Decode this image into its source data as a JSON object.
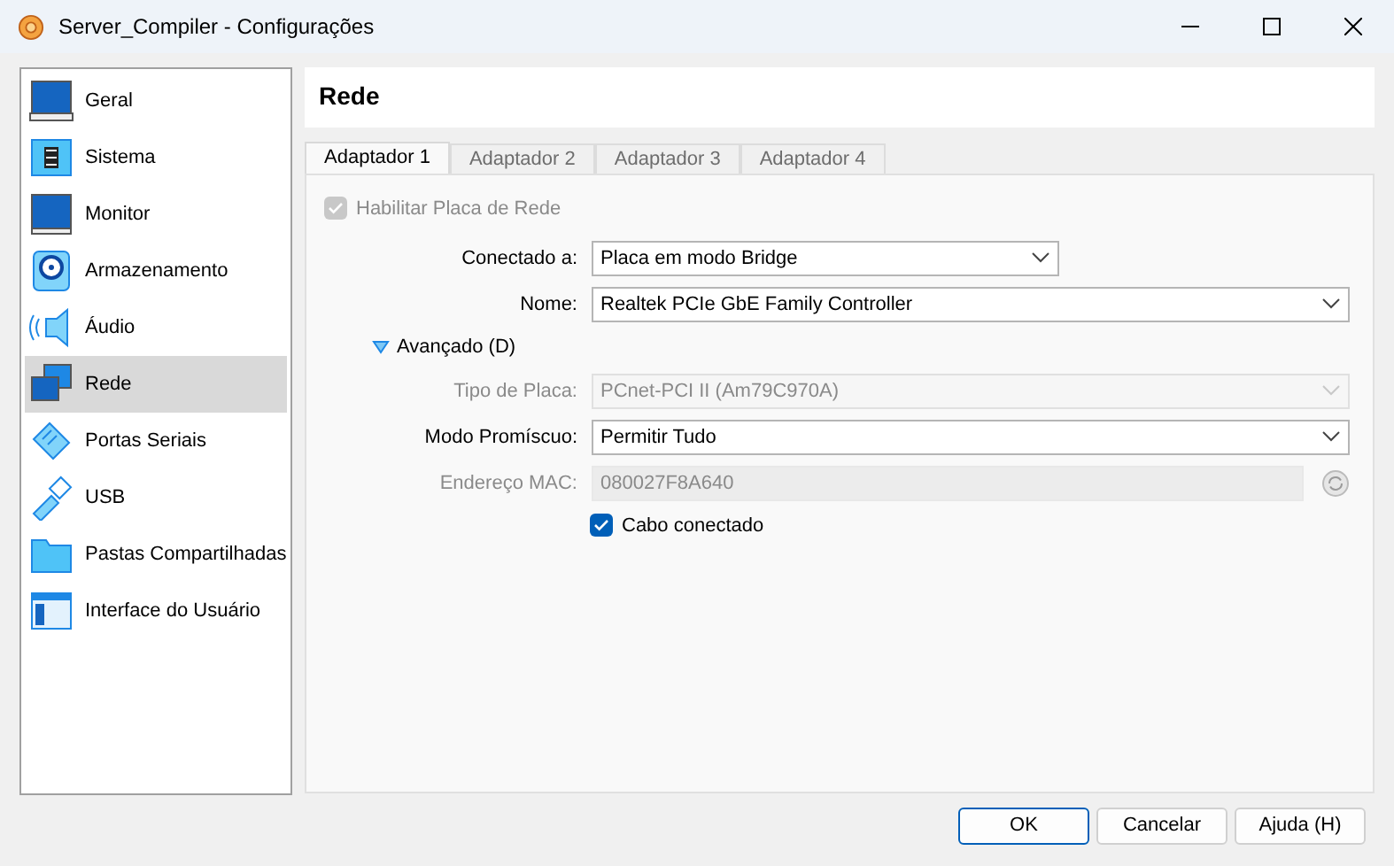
{
  "window": {
    "title": "Server_Compiler - Configurações"
  },
  "sidebar": {
    "items": [
      {
        "label": "Geral",
        "selected": false
      },
      {
        "label": "Sistema",
        "selected": false
      },
      {
        "label": "Monitor",
        "selected": false
      },
      {
        "label": "Armazenamento",
        "selected": false
      },
      {
        "label": "Áudio",
        "selected": false
      },
      {
        "label": "Rede",
        "selected": true
      },
      {
        "label": "Portas Seriais",
        "selected": false
      },
      {
        "label": "USB",
        "selected": false
      },
      {
        "label": "Pastas Compartilhadas",
        "selected": false
      },
      {
        "label": "Interface do Usuário",
        "selected": false
      }
    ]
  },
  "section_title": "Rede",
  "tabs": [
    {
      "label": "Adaptador 1",
      "selected": true
    },
    {
      "label": "Adaptador 2",
      "selected": false
    },
    {
      "label": "Adaptador 3",
      "selected": false
    },
    {
      "label": "Adaptador 4",
      "selected": false
    }
  ],
  "enable_adapter": {
    "label": "Habilitar Placa de Rede",
    "checked": true,
    "disabled": true
  },
  "fields_top": [
    {
      "label": "Conectado a:",
      "value": "Placa em modo Bridge",
      "kind": "select",
      "disabled": false,
      "wide": false
    },
    {
      "label": "Nome:",
      "value": "Realtek PCIe GbE Family Controller",
      "kind": "select",
      "disabled": false,
      "wide": true
    }
  ],
  "advanced": {
    "label": "Avançado (D)",
    "expanded": true
  },
  "fields_advanced": [
    {
      "label": "Tipo de Placa:",
      "value": "PCnet-PCI II (Am79C970A)",
      "kind": "select",
      "disabled": true,
      "wide": true
    },
    {
      "label": "Modo Promíscuo:",
      "value": "Permitir Tudo",
      "kind": "select",
      "disabled": false,
      "wide": true
    },
    {
      "label": "Endereço MAC:",
      "value": "080027F8A640",
      "kind": "mac",
      "disabled": true,
      "wide": true
    }
  ],
  "cable": {
    "label": "Cabo conectado",
    "checked": true
  },
  "buttons": [
    {
      "label": "OK",
      "default": true
    },
    {
      "label": "Cancelar",
      "default": false
    },
    {
      "label": "Ajuda (H)",
      "default": false
    }
  ]
}
